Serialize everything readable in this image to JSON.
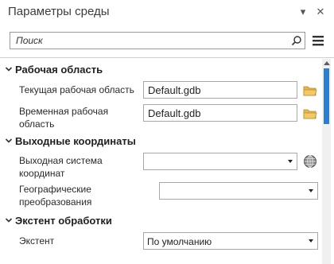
{
  "pane": {
    "title": "Параметры среды",
    "dropdown_glyph": "▾",
    "close_glyph": "✕"
  },
  "search": {
    "placeholder": "Поиск"
  },
  "groups": [
    {
      "label": "Рабочая область",
      "properties": [
        {
          "label": "Текущая рабочая область",
          "value": "Default.gdb",
          "icon": "folder-icon"
        },
        {
          "label": "Временная рабочая область",
          "value": "Default.gdb",
          "icon": "folder-icon"
        }
      ]
    },
    {
      "label": "Выходные координаты",
      "properties": [
        {
          "label": "Выходная система координат",
          "value": "",
          "icon": "globe-icon"
        },
        {
          "label": "Географические преобразования",
          "value": ""
        }
      ]
    },
    {
      "label": "Экстент обработки",
      "properties": [
        {
          "label": "Экстент",
          "value": "По умолчанию"
        }
      ]
    }
  ],
  "colors": {
    "accent": "#2c7fd0",
    "folder": "#e8b54a"
  }
}
